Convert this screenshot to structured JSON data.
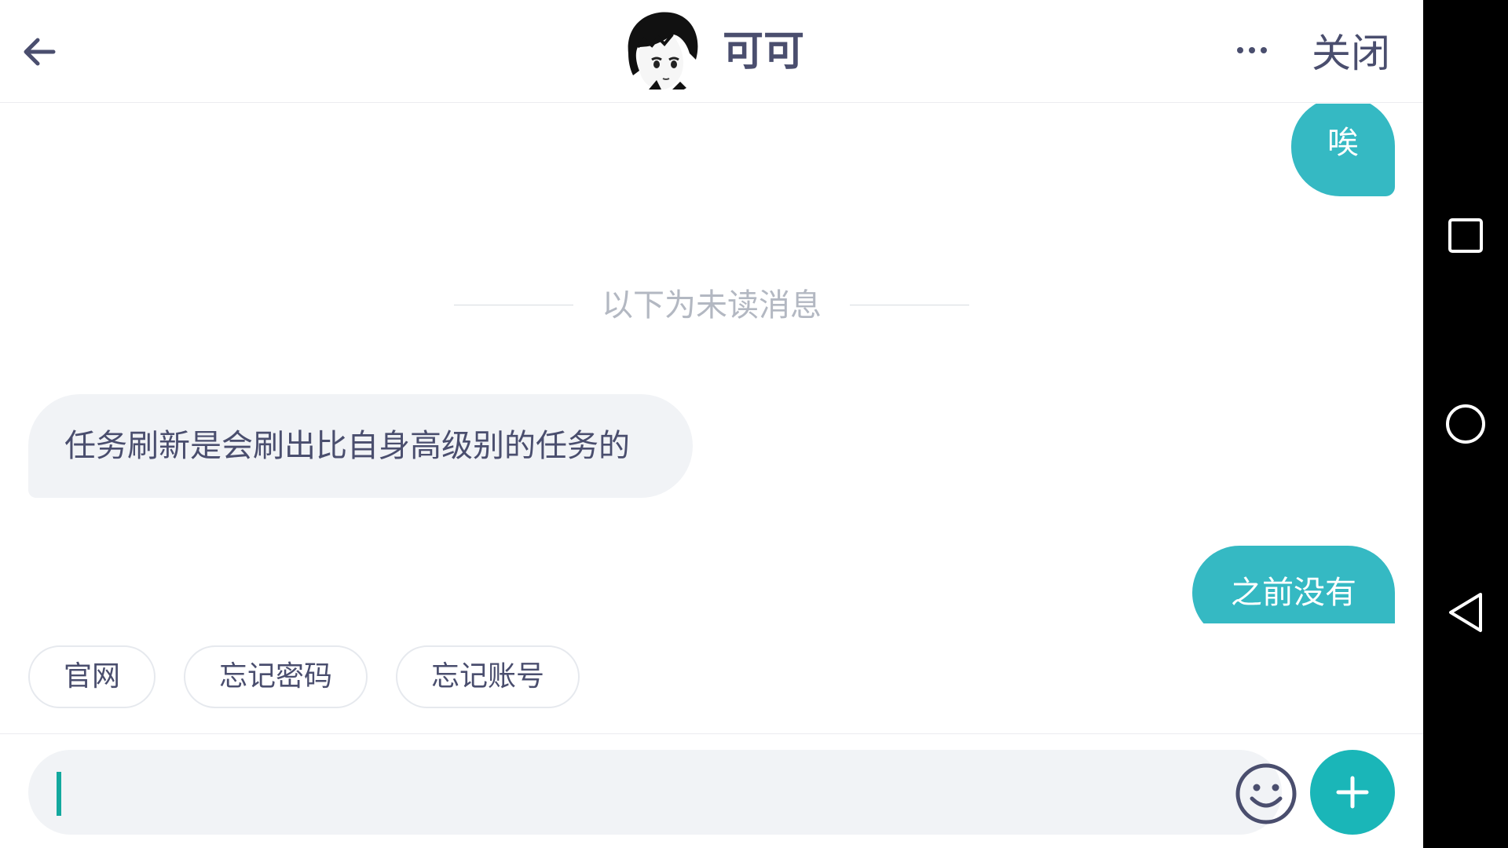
{
  "header": {
    "contact_name": "可可",
    "close_label": "关闭",
    "back_icon": "arrow-left-icon",
    "more_icon": "more-horizontal-icon"
  },
  "messages": {
    "divider_text": "以下为未读消息",
    "items": [
      {
        "direction": "outgoing",
        "text": "唉"
      },
      {
        "direction": "incoming",
        "text": "任务刷新是会刷出比自身高级别的任务的"
      },
      {
        "direction": "outgoing",
        "text": "之前没有"
      }
    ]
  },
  "quick_replies": [
    "官网",
    "忘记密码",
    "忘记账号"
  ],
  "composer": {
    "value": "",
    "emoji_icon": "smiley-icon",
    "plus_icon": "plus-icon"
  },
  "system_nav": {
    "buttons": [
      "recent-apps-icon",
      "home-icon",
      "back-triangle-icon"
    ]
  },
  "colors": {
    "accent": "#35b9c3",
    "plus_button": "#1ab6b8",
    "text": "#4a4e6e",
    "muted": "#b3b8c2",
    "incoming_bubble": "#f1f3f6"
  }
}
